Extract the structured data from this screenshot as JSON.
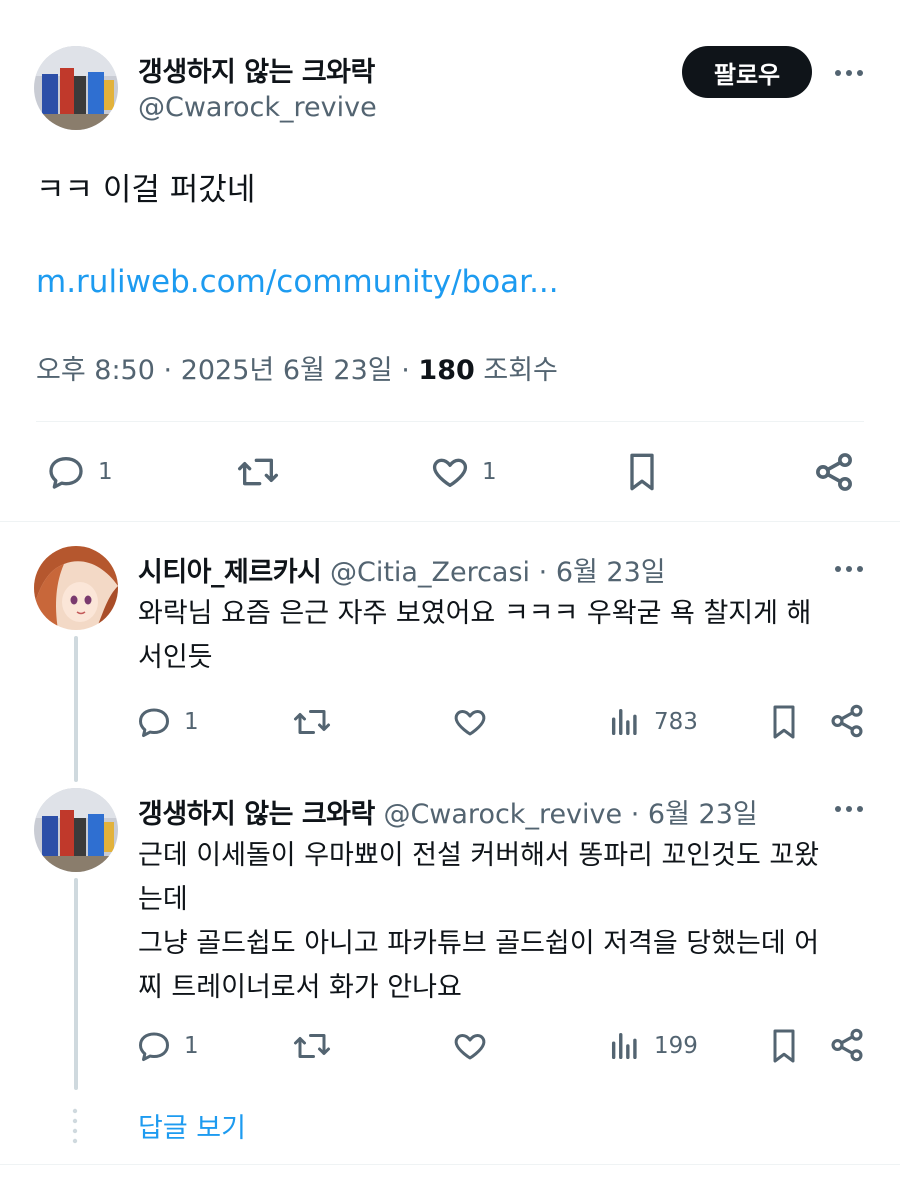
{
  "tweet": {
    "author_name": "갱생하지 않는 크와락",
    "author_handle": "@Cwarock_revive",
    "follow_label": "팔로우",
    "text": "ㅋㅋ 이걸 퍼갔네",
    "link": "m.ruliweb.com/community/boar...",
    "time": "오후 8:50",
    "date": "2025년 6월 23일",
    "views": "180",
    "views_label": "조회수",
    "actions": {
      "reply_count": "1",
      "retweet_count": "",
      "like_count": "1"
    }
  },
  "replies": [
    {
      "name": "시티아_제르카시",
      "handle": "@Citia_Zercasi",
      "date": "6월 23일",
      "lines": [
        "와락님 요즘 은근 자주 보였어요 ㅋㅋㅋ 우왁굳 욕 찰지게 해",
        "서인듯"
      ],
      "reply_count": "1",
      "views": "783"
    },
    {
      "name": "갱생하지 않는 크와락",
      "handle": "@Cwarock_revive",
      "date": "6월 23일",
      "lines": [
        "근데 이세돌이 우마뾰이 전설 커버해서 똥파리 꼬인것도 꼬왔",
        "는데",
        "그냥 골드쉽도 아니고 파카튜브 골드쉽이 저격을 당했는데 어",
        "찌 트레이너로서 화가 안나요"
      ],
      "reply_count": "1",
      "views": "199"
    }
  ],
  "separator": "·",
  "view_replies_label": "답글 보기",
  "colors": {
    "link": "#1d9bf0",
    "secondary": "#536471",
    "primary": "#0f1419",
    "divider": "#eff3f4"
  }
}
